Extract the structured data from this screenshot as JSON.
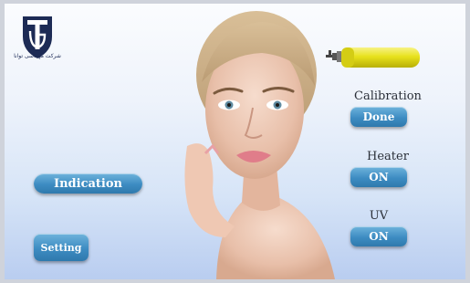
{
  "logo": {
    "caption": "شرکت مهندسی توانا"
  },
  "calibration": {
    "label": "Calibration",
    "value": "Done"
  },
  "heater": {
    "label": "Heater",
    "value": "ON"
  },
  "uv": {
    "label": "UV",
    "value": "ON"
  },
  "buttons": {
    "indication": "Indication",
    "setting": "Setting"
  },
  "colors": {
    "button_blue": "#3d8cc2",
    "gas_cylinder": "#e8e21c",
    "background": "#d6e4f7"
  }
}
